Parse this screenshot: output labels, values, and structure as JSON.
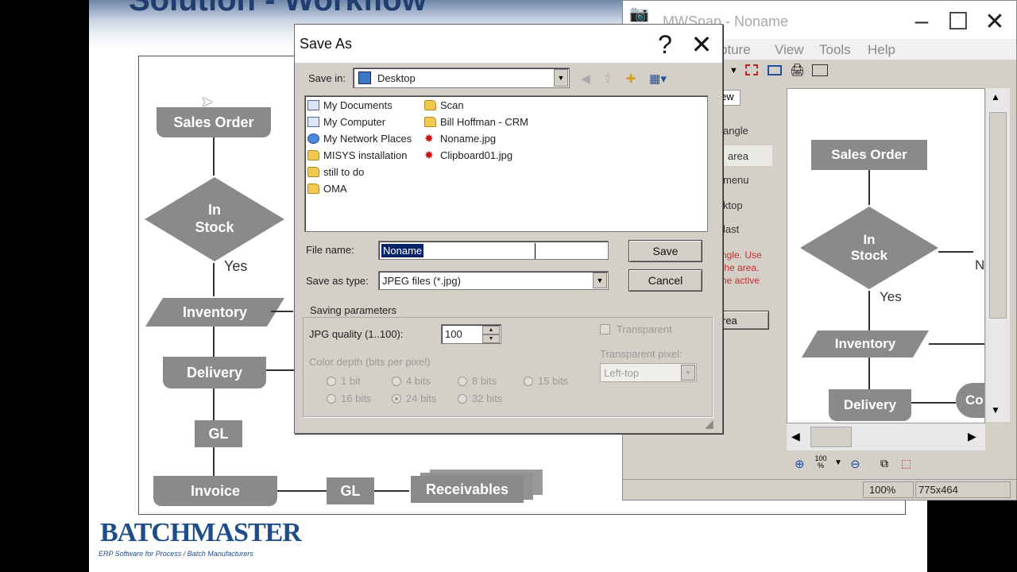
{
  "slide": {
    "title": "Solution - Workflow",
    "flowchart": {
      "sales_order": "Sales Order",
      "in_stock": "In Stock",
      "yes": "Yes",
      "inventory": "Inventory",
      "delivery": "Delivery",
      "gl1": "GL",
      "invoice": "Invoice",
      "gl2": "GL",
      "receivables": "Receivables"
    },
    "logo": "BATCHMASTER",
    "logo_tagline": "ERP Software for Process / Batch Manufacturers"
  },
  "mwsnap": {
    "title": "MWSnap - Noname",
    "menu": [
      "pture",
      "View",
      "Tools",
      "Help"
    ],
    "tab_label": "ew",
    "left_items": [
      "angle",
      "area",
      "menu",
      "ktop",
      "last"
    ],
    "hint_text": [
      "ngle. Use",
      "the area.",
      "he active"
    ],
    "capture_button": "rea",
    "preview": {
      "sales_order": "Sales Order",
      "in_stock": "In Stock",
      "yes": "Yes",
      "n": "N",
      "inventory": "Inventory",
      "delivery": "Delivery",
      "co": "Co"
    },
    "zoom_label": "100 %",
    "status": {
      "zoom": "100%",
      "size": "775x464"
    },
    "colors": {
      "hint": "#c03030"
    }
  },
  "dialog": {
    "title": "Save As",
    "save_in_label": "Save in:",
    "save_in_value": "Desktop",
    "files_col1": [
      {
        "name": "My Documents",
        "icon": "documents-icon"
      },
      {
        "name": "My Computer",
        "icon": "computer-icon"
      },
      {
        "name": "My Network Places",
        "icon": "network-icon"
      },
      {
        "name": "MISYS installation",
        "icon": "folder-icon"
      },
      {
        "name": "still to do",
        "icon": "folder-icon"
      },
      {
        "name": "OMA",
        "icon": "folder-icon"
      }
    ],
    "files_col2": [
      {
        "name": "Scan",
        "icon": "folder-icon"
      },
      {
        "name": "Bill Hoffman - CRM",
        "icon": "folder-icon"
      },
      {
        "name": "Noname.jpg",
        "icon": "image-icon"
      },
      {
        "name": "Clipboard01.jpg",
        "icon": "image-icon"
      }
    ],
    "file_name_label": "File name:",
    "file_name_value": "Noname",
    "save_as_type_label": "Save as type:",
    "save_as_type_value": "JPEG files (*.jpg)",
    "save_button": "Save",
    "cancel_button": "Cancel",
    "params": {
      "group_label": "Saving parameters",
      "quality_label": "JPG quality (1..100):",
      "quality_value": "100",
      "transparent_label": "Transparent",
      "transparent_pixel_label": "Transparent pixel:",
      "transparent_pixel_value": "Left-top",
      "color_depth_label": "Color depth (bits per pixel)",
      "depths": [
        "1 bit",
        "4 bits",
        "8 bits",
        "15 bits",
        "16 bits",
        "24 bits",
        "32 bits"
      ],
      "selected_depth": "24 bits"
    }
  }
}
